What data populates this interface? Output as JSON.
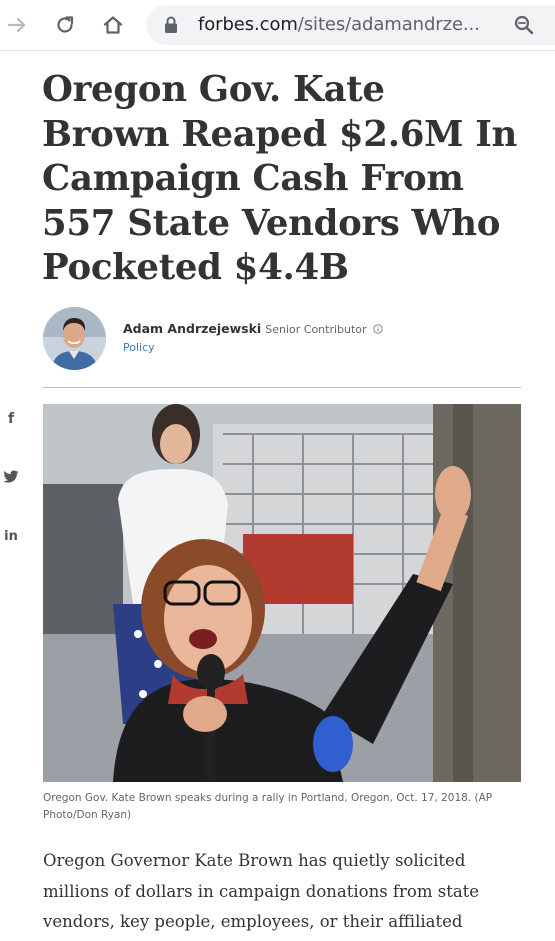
{
  "browser": {
    "url_domain": "forbes.com",
    "url_rest": "/sites/adamandrze..."
  },
  "article": {
    "headline": "Oregon Gov. Kate Brown Reaped $2.6M In Campaign Cash From 557 State Vendors Who Pocketed $4.4B",
    "author": {
      "name": "Adam Andrzejewski",
      "role": "Senior Contributor",
      "section": "Policy"
    },
    "caption": "Oregon Gov. Kate Brown speaks during a rally in Portland, Oregon, Oct. 17, 2018. (AP Photo/Don Ryan)",
    "body": "Oregon Governor Kate Brown has quietly solicited millions of dollars in campaign donations from state vendors, key people, employees, or their affiliated corporate political"
  },
  "social": {
    "facebook": "f",
    "linkedin": "in"
  },
  "icons": {
    "forward": "arrow-right-icon",
    "reload": "reload-icon",
    "home": "home-icon",
    "lock": "lock-icon",
    "zoom": "zoom-icon",
    "info": "info-icon",
    "twitter": "twitter-bird-icon"
  },
  "colors": {
    "headline": "#333333",
    "link": "#3a7bb3",
    "omnibox": "#f1f3f4"
  }
}
